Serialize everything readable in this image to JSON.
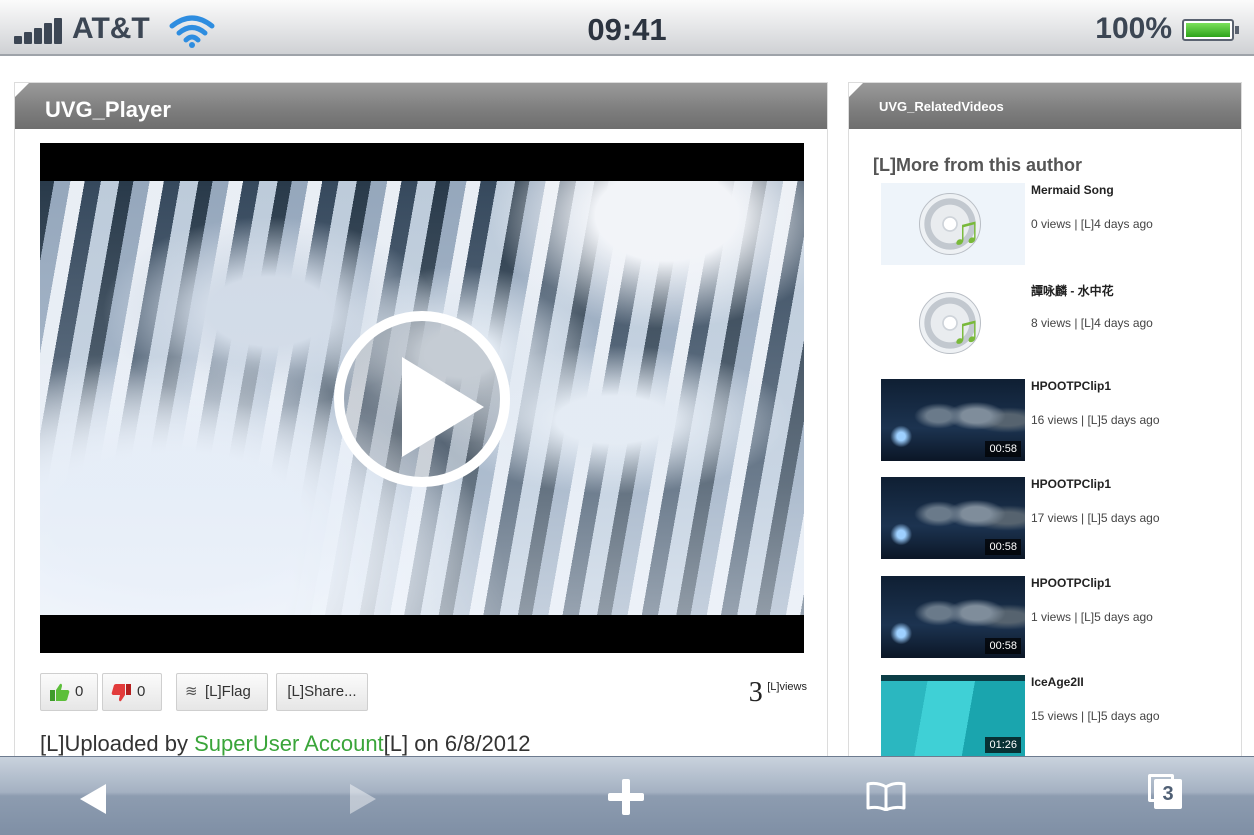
{
  "status_bar": {
    "carrier": "AT&T",
    "time": "09:41",
    "battery": "100%"
  },
  "player": {
    "title": "UVG_Player",
    "likes": "0",
    "dislikes": "0",
    "flag_label": "[L]Flag",
    "share_label": "[L]Share...",
    "views_count": "3",
    "views_label": "[L]views",
    "upload_prefix": "[L]Uploaded by",
    "uploader": "SuperUser Account",
    "upload_suffix": "[L] on 6/8/2012"
  },
  "related": {
    "title": "UVG_RelatedVideos",
    "section_title": "[L]More from this author",
    "items": [
      {
        "title": "Mermaid Song",
        "meta": "0 views | [L]4 days ago",
        "thumb": "music-cd-icon",
        "duration": ""
      },
      {
        "title": "譚咏麟 - 水中花",
        "meta": "8 views | [L]4 days ago",
        "thumb": "music-cd-icon",
        "duration": ""
      },
      {
        "title": "HPOOTPClip1",
        "meta": "16 views | [L]5 days ago",
        "thumb": "video",
        "duration": "00:58"
      },
      {
        "title": "HPOOTPClip1",
        "meta": "17 views | [L]5 days ago",
        "thumb": "video",
        "duration": "00:58"
      },
      {
        "title": "HPOOTPClip1",
        "meta": "1 views | [L]5 days ago",
        "thumb": "video",
        "duration": "00:58"
      },
      {
        "title": "IceAge2II",
        "meta": "15 views | [L]5 days ago",
        "thumb": "video",
        "duration": "01:26"
      }
    ]
  },
  "toolbar": {
    "tab_count": "3"
  },
  "colors": {
    "accent_link": "#3aa53a",
    "panel_header": "#7d7d7d",
    "toolbar": "#8d9cb0"
  }
}
